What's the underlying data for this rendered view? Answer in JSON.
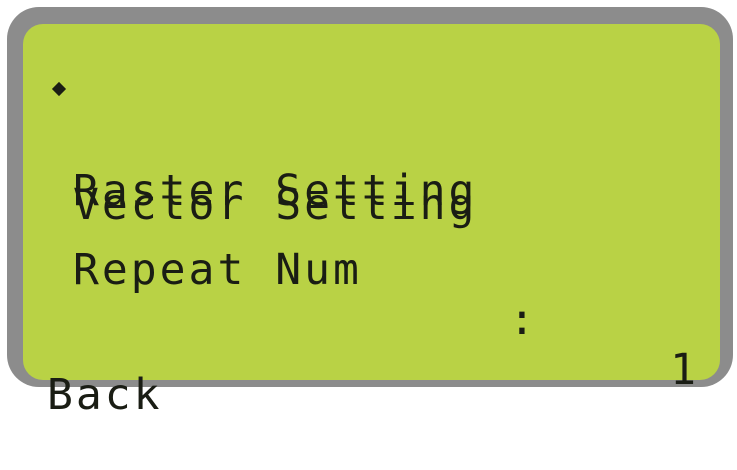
{
  "menu": {
    "items": [
      {
        "label": "Raster Setting",
        "selected": true
      },
      {
        "label": "Vector Setting",
        "selected": false
      },
      {
        "label": "Repeat Num",
        "separator": ":",
        "value": "1",
        "selected": false
      }
    ],
    "back_label": "Back"
  },
  "icons": {
    "cursor": "diamond-cursor-icon"
  },
  "colors": {
    "lcd_background": "#b9d245",
    "bezel": "#8c8c8c",
    "text": "#1a1d14"
  }
}
